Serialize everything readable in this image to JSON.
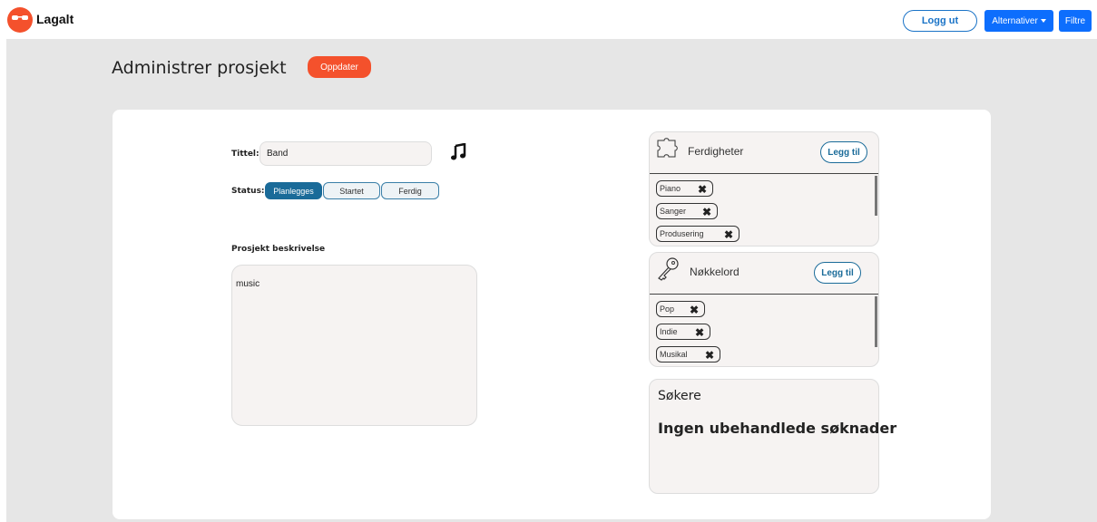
{
  "header": {
    "brand": "Lagalt",
    "logout_label": "Logg ut",
    "options_label": "Alternativer",
    "filter_label": "Filtre"
  },
  "page": {
    "title": "Administrer prosjekt",
    "update_label": "Oppdater"
  },
  "form": {
    "title_label": "Tittel:",
    "title_value": "Band",
    "status_label": "Status:",
    "status_options": [
      "Planlegges",
      "Startet",
      "Ferdig"
    ],
    "status_selected": "Planlegges",
    "description_label": "Prosjekt beskrivelse",
    "description_value": "music"
  },
  "skills": {
    "title": "Ferdigheter",
    "add_label": "Legg til",
    "items": [
      "Piano",
      "Sanger",
      "Produsering"
    ]
  },
  "keywords": {
    "title": "Nøkkelord",
    "add_label": "Legg til",
    "items": [
      "Pop",
      "Indie",
      "Musikal"
    ]
  },
  "applicants": {
    "title": "Søkere",
    "empty_text": "Ingen ubehandlede søknader"
  },
  "icons": {
    "logo": "sunglasses-face-icon",
    "project_type": "music-note-icon",
    "skills": "puzzle-piece-icon",
    "keywords": "key-icon",
    "remove": "close-x-icon"
  },
  "colors": {
    "brand": "#f4512c",
    "primary": "#0d6efd",
    "accent": "#1a6b99",
    "panel_bg": "#f6f3f2",
    "page_bg": "#e6e6e6"
  }
}
